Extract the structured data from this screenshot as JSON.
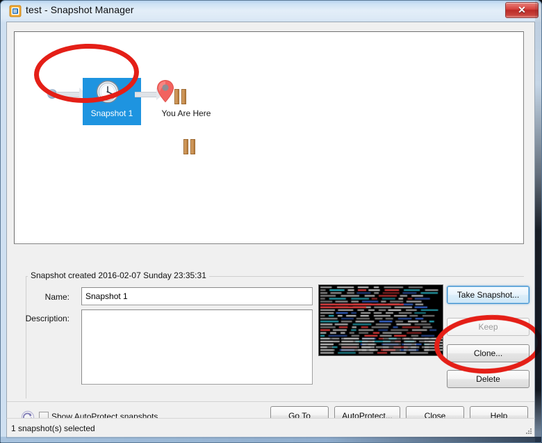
{
  "window": {
    "title": "test - Snapshot Manager",
    "app_icon": "vmware-icon",
    "close_label": "✕"
  },
  "tree": {
    "root_node_name": "root-node-dot",
    "snapshot": {
      "label": "Snapshot 1",
      "icon": "clock-icon",
      "badge_icon": "pause-badge-icon",
      "selected": true,
      "selection_color": "#1e94e0"
    },
    "you_are_here": {
      "label": "You Are Here",
      "icon": "map-pin-icon",
      "badge_icon": "pause-badge-icon"
    }
  },
  "details": {
    "group_title": "Snapshot created 2016-02-07 Sunday 23:35:31",
    "name_label": "Name:",
    "name_value": "Snapshot 1",
    "description_label": "Description:",
    "description_value": "",
    "thumbnail_alt": "vm-screen-thumbnail"
  },
  "actions": {
    "take_snapshot": "Take Snapshot...",
    "keep": "Keep",
    "clone": "Clone...",
    "delete": "Delete"
  },
  "bottom": {
    "autoprotect_icon": "autoprotect-refresh-icon",
    "show_autoprotect_label": "Show AutoProtect snapshots",
    "show_autoprotect_checked": false,
    "go_to": "Go To",
    "autoprotect": "AutoProtect...",
    "close": "Close",
    "help": "Help"
  },
  "status": {
    "text": "1 snapshot(s) selected"
  },
  "annotations": {
    "color": "#e41f17",
    "items": [
      "snapshot-node-highlight",
      "clone-delete-highlight"
    ]
  }
}
